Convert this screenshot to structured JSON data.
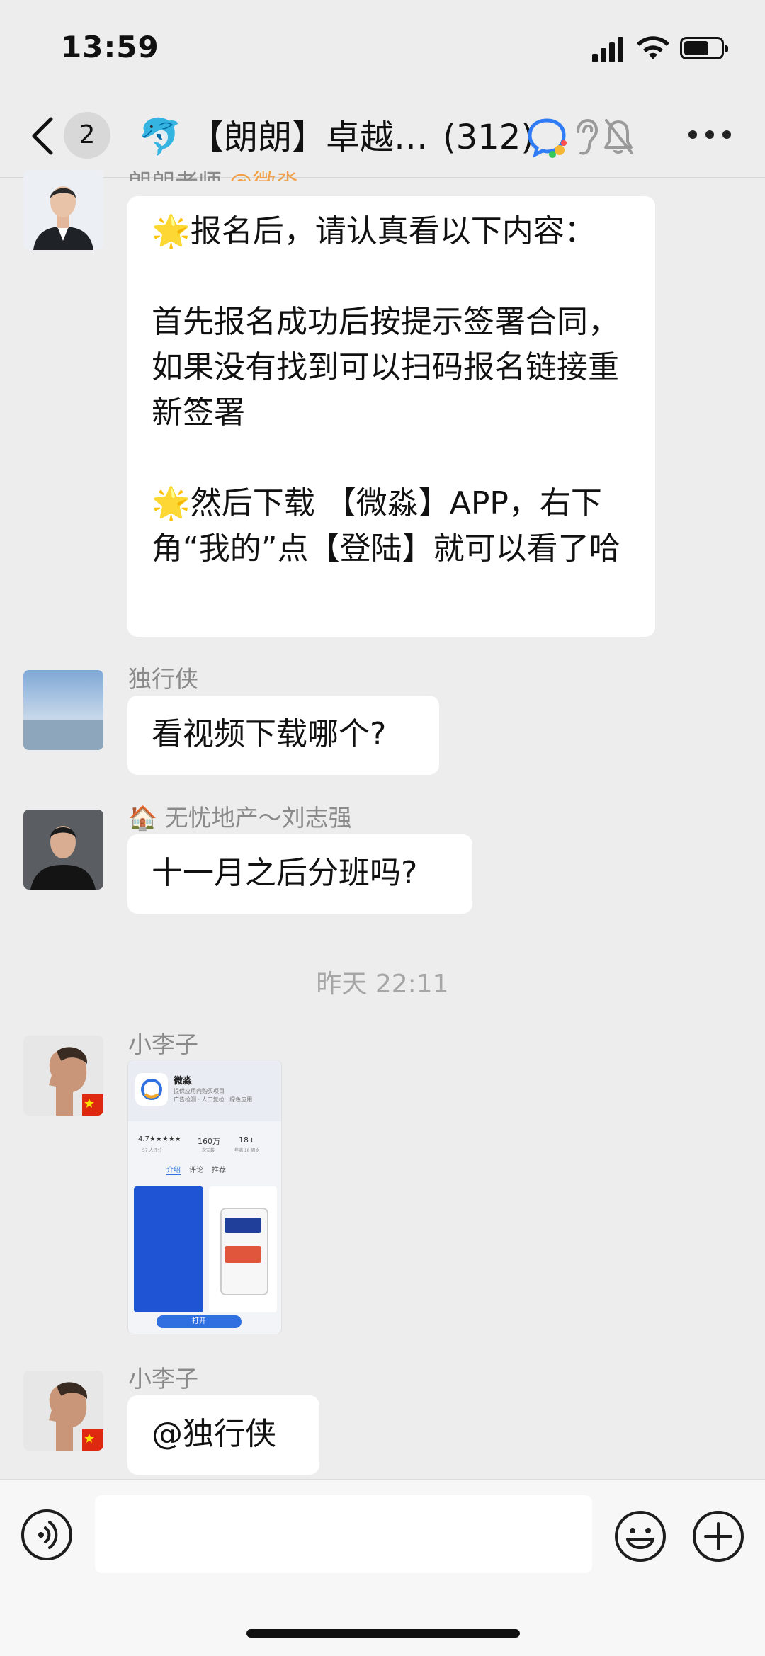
{
  "status_bar": {
    "time": "13:59"
  },
  "header": {
    "back_count": "2",
    "group_emoji": "🐬",
    "title": "【朗朗】卓越…",
    "member_count": "(312)",
    "icons": [
      "chat-bubble-icon",
      "ear-icon",
      "bell-muted-icon",
      "more-icon"
    ]
  },
  "messages": [
    {
      "sender": "朗朗老师",
      "sender_tag": "@微淼",
      "bubble": "🌟报名后，请认真看以下内容：\n\n首先报名成功后按提示签署合同，如果没有找到可以扫码报名链接重新签署\n\n🌟然后下载 【微淼】APP，右下角“我的”点【登陆】就可以看了哈"
    },
    {
      "sender": "独行侠",
      "bubble": "看视频下载哪个?"
    },
    {
      "sender": "🏠 无忧地产～刘志强",
      "bubble": "十一月之后分班吗?"
    },
    {
      "sender": "小李子",
      "image_alt": "app-store-screenshot"
    },
    {
      "sender": "小李子",
      "bubble": "@独行侠"
    }
  ],
  "time_separator": "昨天 22:11",
  "shared_image": {
    "app_name": "微淼",
    "app_subtitle": "提供应用内购买项目",
    "app_tags": "广告检测 · 人工复检 · 绿色应用",
    "rating": "4.7★★★★★",
    "rating_sub": "57 人评分",
    "downloads": "160万",
    "downloads_sub": "次安装",
    "age": "18+",
    "age_sub": "年满 18 周岁",
    "tabs": [
      "介绍",
      "评论",
      "推荐"
    ],
    "open_label": "打开"
  },
  "input": {
    "placeholder": ""
  }
}
